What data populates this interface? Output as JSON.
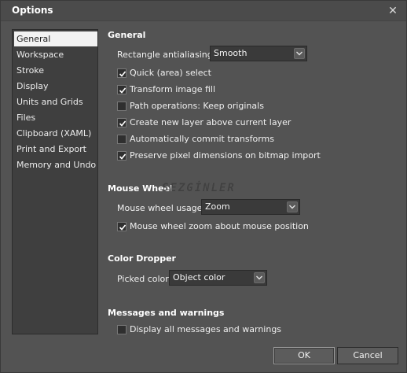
{
  "window": {
    "title": "Options"
  },
  "sidebar": {
    "items": [
      {
        "label": "General",
        "selected": true
      },
      {
        "label": "Workspace"
      },
      {
        "label": "Stroke"
      },
      {
        "label": "Display"
      },
      {
        "label": "Units and Grids"
      },
      {
        "label": "Files"
      },
      {
        "label": "Clipboard (XAML)"
      },
      {
        "label": "Print and Export"
      },
      {
        "label": "Memory and Undo"
      }
    ]
  },
  "general": {
    "title": "General",
    "antialias_label": "Rectangle antialiasing",
    "antialias_value": "Smooth",
    "options": [
      {
        "label": "Quick (area) select",
        "checked": true
      },
      {
        "label": "Transform image fill",
        "checked": true
      },
      {
        "label": "Path operations: Keep originals",
        "checked": false
      },
      {
        "label": "Create new layer above current layer",
        "checked": true
      },
      {
        "label": "Automatically commit transforms",
        "checked": false
      },
      {
        "label": "Preserve pixel dimensions on bitmap import",
        "checked": true
      }
    ]
  },
  "mouse_wheel": {
    "title": "Mouse Wheel",
    "usage_label": "Mouse wheel usage",
    "usage_value": "Zoom",
    "zoom_option": {
      "label": "Mouse wheel zoom about mouse position",
      "checked": true
    }
  },
  "color_dropper": {
    "title": "Color Dropper",
    "picked_label": "Picked color",
    "picked_value": "Object color"
  },
  "messages": {
    "title": "Messages and warnings",
    "display_all": {
      "label": "Display all messages and warnings",
      "checked": false
    }
  },
  "buttons": {
    "ok": "OK",
    "cancel": "Cancel"
  },
  "watermark": "SEZGİNLER",
  "colors": {
    "background": "#535353",
    "sidebar": "#3f3f3f",
    "selected": "#f2f2f2"
  }
}
